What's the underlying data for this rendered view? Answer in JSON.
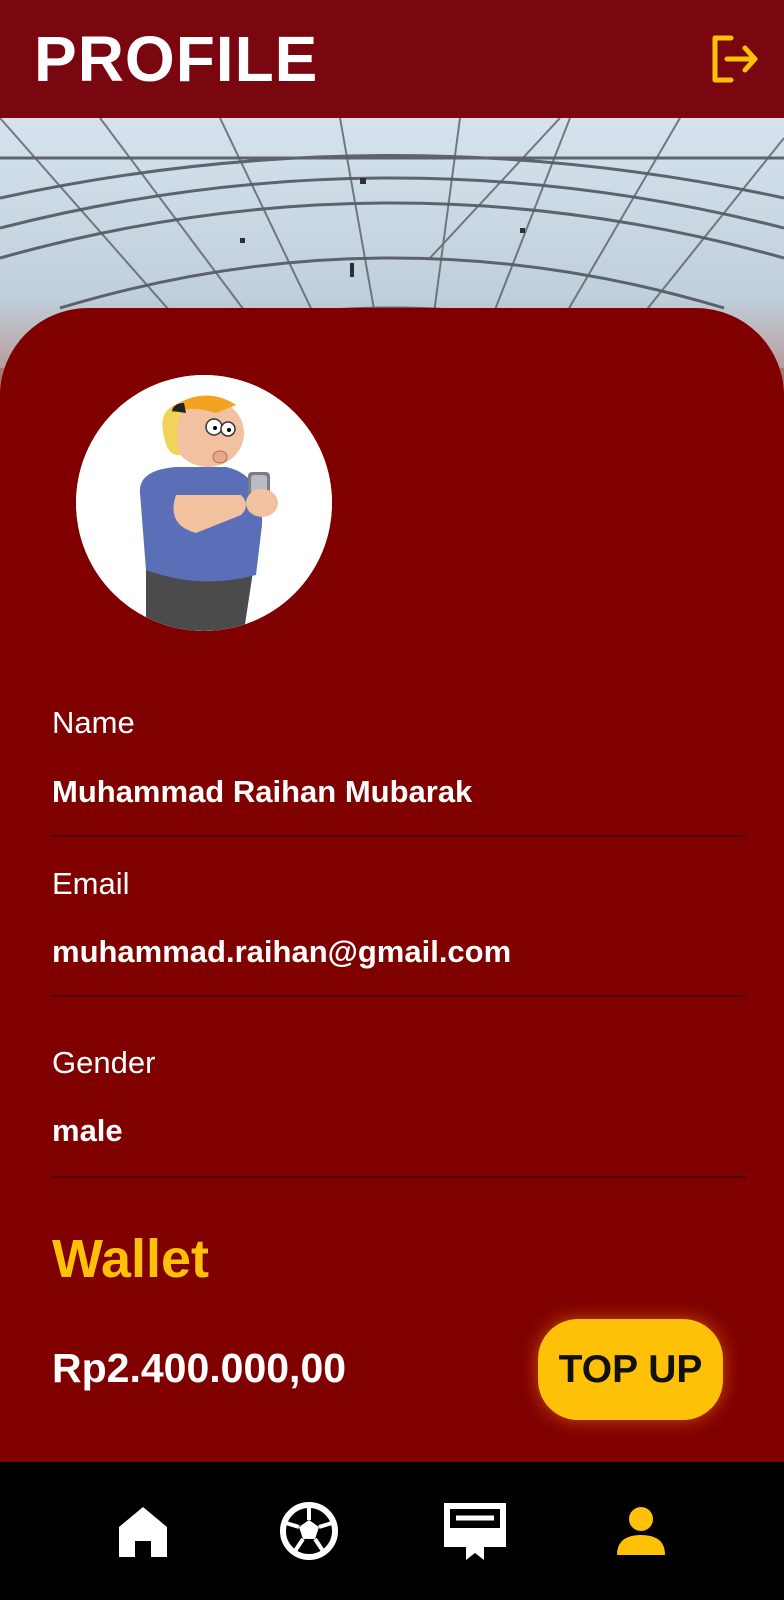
{
  "header": {
    "title": "PROFILE",
    "logout_icon": "logout-icon"
  },
  "profile": {
    "name_label": "Name",
    "name_value": "Muhammad Raihan Mubarak",
    "email_label": "Email",
    "email_value": "muhammad.raihan@gmail.com",
    "gender_label": "Gender",
    "gender_value": "male"
  },
  "wallet": {
    "title": "Wallet",
    "amount": "Rp2.400.000,00",
    "topup_label": "TOP UP"
  },
  "nav": {
    "items": [
      {
        "icon": "home-icon",
        "active": false
      },
      {
        "icon": "soccer-ball-icon",
        "active": false
      },
      {
        "icon": "ticket-icon",
        "active": false
      },
      {
        "icon": "profile-icon",
        "active": true
      }
    ]
  },
  "colors": {
    "header_bg": "#7a0710",
    "card_bg": "#800000",
    "accent": "#ffc107",
    "text": "#ffffff",
    "nav_bg": "#000000"
  }
}
